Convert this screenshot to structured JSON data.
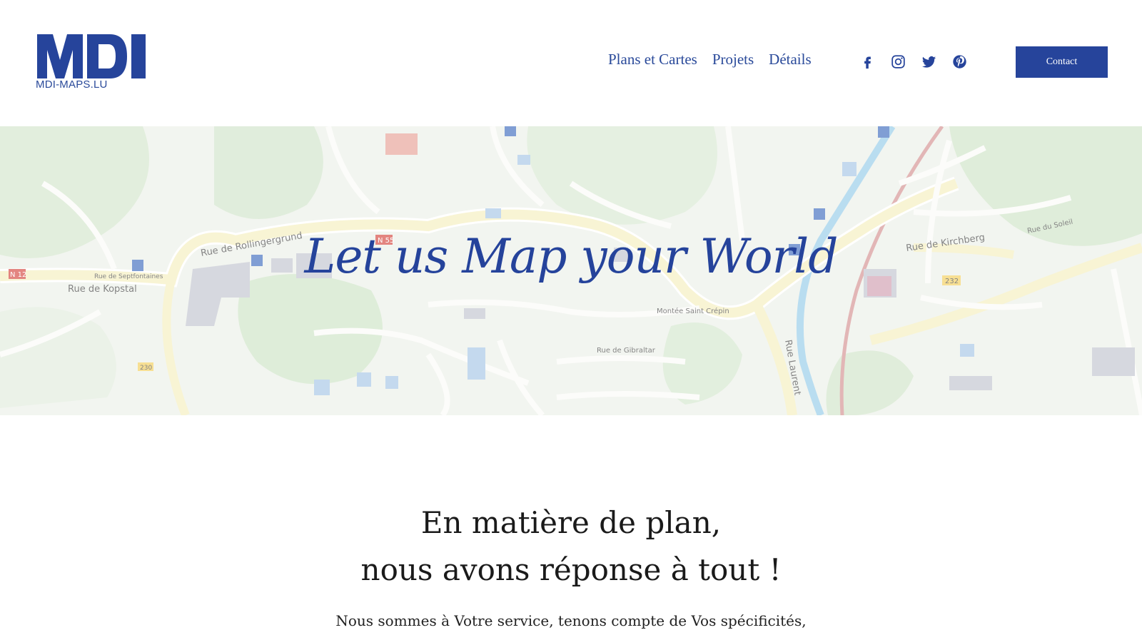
{
  "brand": {
    "logo_text": "MDI",
    "logo_sub": "MDI-MAPS.LU",
    "color": "#26449b"
  },
  "nav": {
    "items": [
      {
        "label": "Plans et Cartes"
      },
      {
        "label": "Projets"
      },
      {
        "label": "Détails"
      }
    ]
  },
  "social": [
    "facebook-icon",
    "instagram-icon",
    "twitter-icon",
    "pinterest-icon"
  ],
  "header": {
    "contact_label": "Contact"
  },
  "hero": {
    "title": "Let us Map your World",
    "map_labels": {
      "rue_de_rollingergrund": "Rue de Rollingergrund",
      "rue_de_kopstal": "Rue de Kopstal",
      "rue_de_kirchberg": "Rue de Kirchberg",
      "rue_laurent": "Rue Laurent",
      "n55": "N 55",
      "n12": "N 12",
      "r232": "232",
      "r230": "230",
      "montee_saint_crepin": "Montée Saint Crépin",
      "rue_de_gibraltar": "Rue de Gibraltar",
      "rue_du_soleil": "Rue du Soleil",
      "rue_de_septfontaines": "Rue de Septfontaines"
    }
  },
  "main": {
    "headline_line1": "En matière de plan,",
    "headline_line2": "nous avons réponse à tout !",
    "subline": "Nous sommes à Votre service, tenons compte de Vos spécificités,"
  }
}
